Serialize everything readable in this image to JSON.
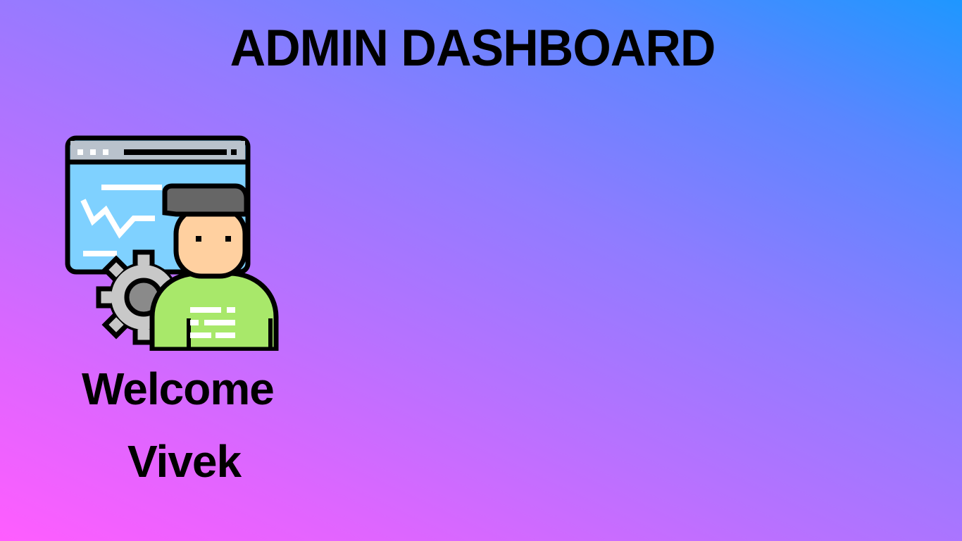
{
  "header": {
    "title": "ADMIN DASHBOARD"
  },
  "illustration": {
    "icon": "admin-user-with-gear-and-monitor-icon"
  },
  "welcome": {
    "greeting": "Welcome",
    "user_name": "Vivek"
  },
  "colors": {
    "gradient_start": "#ff5dff",
    "gradient_end": "#1e97ff",
    "text": "#000000",
    "shirt": "#a8e86a",
    "screen": "#7fd1ff",
    "hair": "#666666",
    "skin": "#ffd0a0",
    "gear": "#c8c8c8"
  }
}
